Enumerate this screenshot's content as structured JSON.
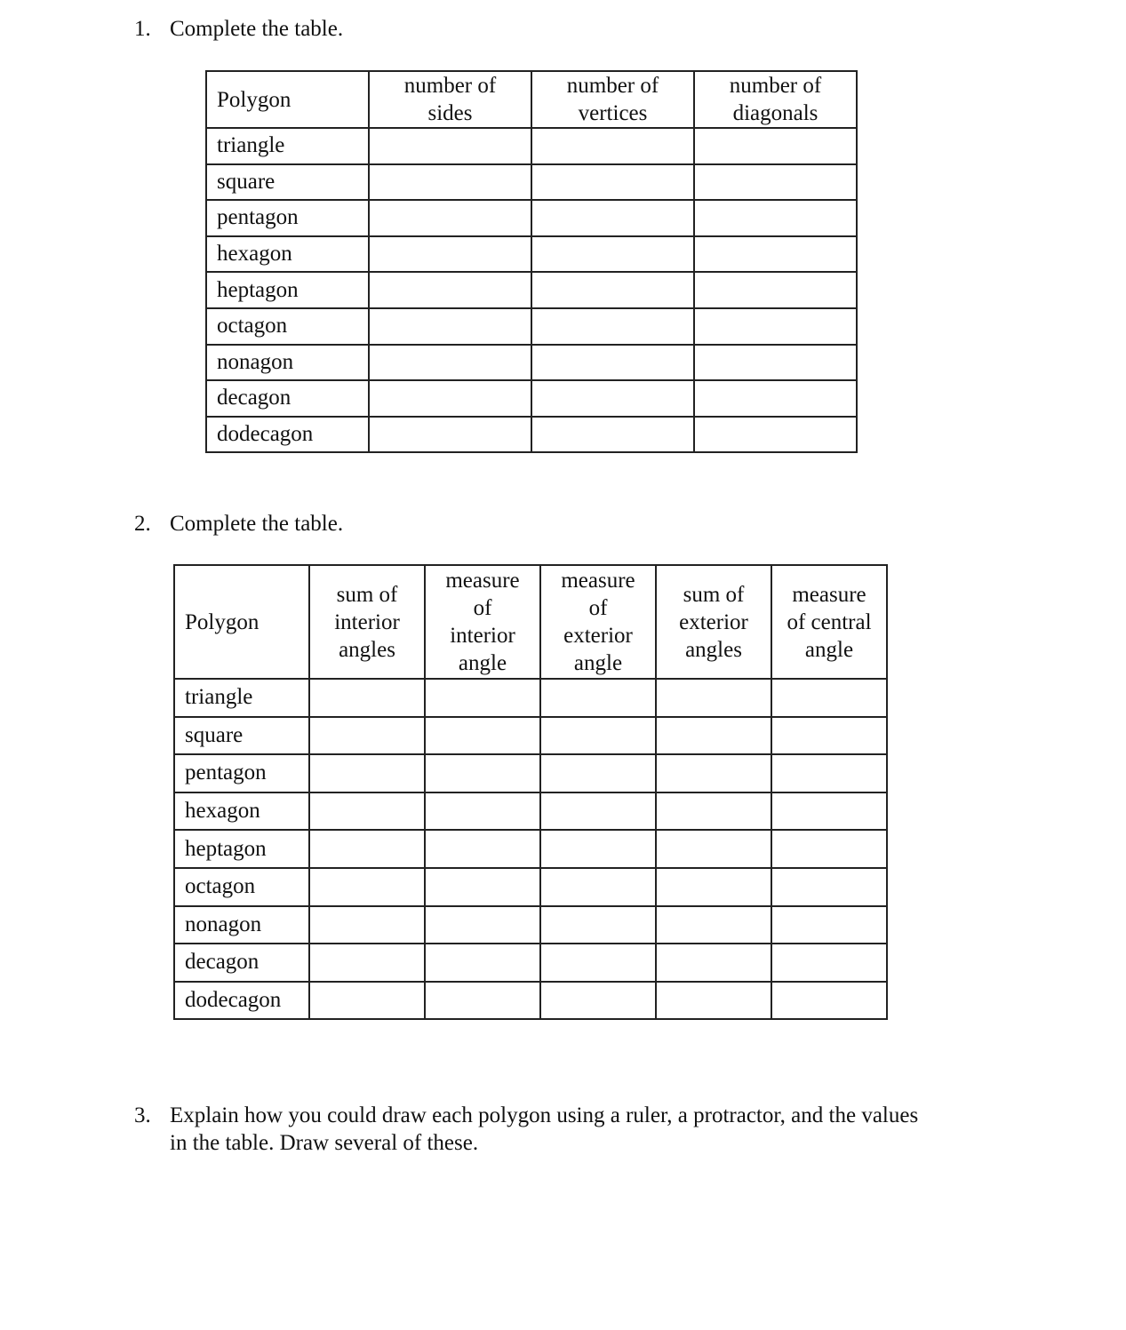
{
  "questions": [
    {
      "number": "1.",
      "text": "Complete the table."
    },
    {
      "number": "2.",
      "text": "Complete the table."
    },
    {
      "number": "3.",
      "text": "Explain how you could draw each polygon using a ruler, a protractor, and the values in the table.  Draw several of these."
    }
  ],
  "table1": {
    "headers": [
      "Polygon",
      "number of sides",
      "number of vertices",
      "number of diagonals"
    ],
    "header_lines": [
      [
        "Polygon"
      ],
      [
        "number of",
        "sides"
      ],
      [
        "number of",
        "vertices"
      ],
      [
        "number of",
        "diagonals"
      ]
    ],
    "rows": [
      "triangle",
      "square",
      "pentagon",
      "hexagon",
      "heptagon",
      "octagon",
      "nonagon",
      "decagon",
      "dodecagon"
    ]
  },
  "table2": {
    "headers": [
      "Polygon",
      "sum of interior angles",
      "measure of interior angle",
      "measure of exterior angle",
      "sum of exterior angles",
      "measure of central angle"
    ],
    "header_lines": [
      [
        "Polygon"
      ],
      [
        "sum of",
        "interior",
        "angles"
      ],
      [
        "measure",
        "of",
        "interior",
        "angle"
      ],
      [
        "measure",
        "of",
        "exterior",
        "angle"
      ],
      [
        "sum of",
        "exterior",
        "angles"
      ],
      [
        "measure",
        "of central",
        "angle"
      ]
    ],
    "rows": [
      "triangle",
      "square",
      "pentagon",
      "hexagon",
      "heptagon",
      "octagon",
      "nonagon",
      "decagon",
      "dodecagon"
    ]
  }
}
